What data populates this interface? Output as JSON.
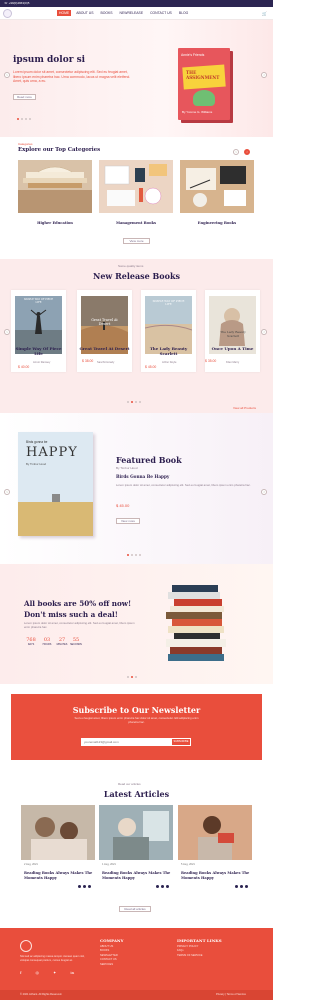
{
  "topbar": {
    "phone": "+99(0)4963(0)5"
  },
  "nav": {
    "items": [
      "HOME",
      "ABOUT US",
      "BOOKS",
      "NEWRELEASE",
      "CONTACT US",
      "BLOG"
    ],
    "active": "HOME"
  },
  "hero": {
    "title": "ipsum dolor si",
    "text": "Lorem ipsum dolor sit amet, consectetur adipiscing elit. Sed eu feugiat amet, libero ipsum enim pharetra hac. Urna commodo, lacus ut magna velit eleifend. Amet, quis urna, a eu.",
    "button": "Read more",
    "book": {
      "top": "Annie's Friends",
      "title": "THE ASSIGNMENT",
      "author": "By Yvonne G. Williams"
    }
  },
  "categories": {
    "label": "Categories",
    "title": "Explore our Top Categories",
    "items": [
      "Higher Education",
      "Management Books",
      "Engineering Books"
    ],
    "button": "View more"
  },
  "new_release": {
    "label": "Some quality items",
    "title": "New Release Books",
    "books": [
      {
        "title": "Simple Way Of Piece Life",
        "author": "Armor Ramsey",
        "price": "$ 40.00",
        "cover": "SIMPLE WAY OF PIECE LIFE"
      },
      {
        "title": "Great Travel At Desert",
        "author": "Sanchit Howdy",
        "price": "$ 38.00",
        "cover": "Great Travel At Desert"
      },
      {
        "title": "The Lady Beauty Scarlett",
        "author": "Arthur Doyle",
        "price": "$ 45.00",
        "cover": "SIMPLE WAY OF PIECE LIFE"
      },
      {
        "title": "Once Upon A Time",
        "author": "Klien Marry",
        "price": "$ 35.00",
        "cover": "The Lady Beauty Scarlett"
      }
    ],
    "view_all": "View all Products"
  },
  "featured": {
    "title": "Featured Book",
    "author_label": "By Timbur Hood",
    "book_title": "Birds Gonna Be Happy",
    "text": "Lorem ipsum dolor sit amet, consectetur adipiscing elit. Sed eu feugiat amet, libero ipsum enim pharetra hac.",
    "price": "$ 45.00",
    "button": "View more",
    "cover": {
      "top": "Birds gonna be",
      "big": "HAPPY",
      "author": "By Timbur Hood"
    }
  },
  "sale": {
    "title_1": "All books are 50% off now!",
    "title_2": "Don't miss such a deal!",
    "text": "Lorem ipsum dolor sit amet, consectetur adipiscing elit. Sed eu feugiat amet, libero ipsum enim pharetra hac.",
    "countdown": [
      {
        "value": "768",
        "label": "DAYS"
      },
      {
        "value": "03",
        "label": "HOURS"
      },
      {
        "value": "27",
        "label": "MINUTES"
      },
      {
        "value": "55",
        "label": "SECONDS"
      }
    ]
  },
  "newsletter": {
    "title": "Subscribe to Our Newsletter",
    "text": "Sed eu feugiat amet, libero ipsum enim pharetra hac dolor sit amet, consectetur. Elit adipiscing enim pharetra hac.",
    "placeholder": "youremail123@gmail.com",
    "button": "SUBSCRIBE"
  },
  "articles": {
    "label": "Read our articles",
    "title": "Latest Articles",
    "items": [
      {
        "date": "2 Aug, 2021",
        "title": "Reading Books Always Makes The Moments Happy"
      },
      {
        "date": "1 Aug, 2021",
        "title": "Reading Books Always Makes The Moments Happy"
      },
      {
        "date": "5 Aug, 2021",
        "title": "Reading Books Always Makes The Moments Happy"
      }
    ],
    "button": "Read all articles"
  },
  "footer": {
    "about": "Nisi sed ac adipiscing massa tempor. Aenean quam nisl, volutpat consequat pretium, cursus feugiat ac.",
    "company_title": "COMPANY",
    "company": [
      "ABOUT US",
      "BOOKS",
      "NEWSLETTER",
      "CONTACT US",
      "SERVICES"
    ],
    "links_title": "IMPORTANT LINKS",
    "links": [
      "PRIVACY POLICY",
      "FAQs",
      "TERMS OF SERVICE"
    ],
    "copyright": "© 2021 Arihant. All Rights Reserved.",
    "legal": "Privacy | Terms of Service"
  },
  "colors": {
    "accent": "#e94e3c",
    "navy": "#2b1d4d",
    "bg_pink": "#fcebeb"
  }
}
